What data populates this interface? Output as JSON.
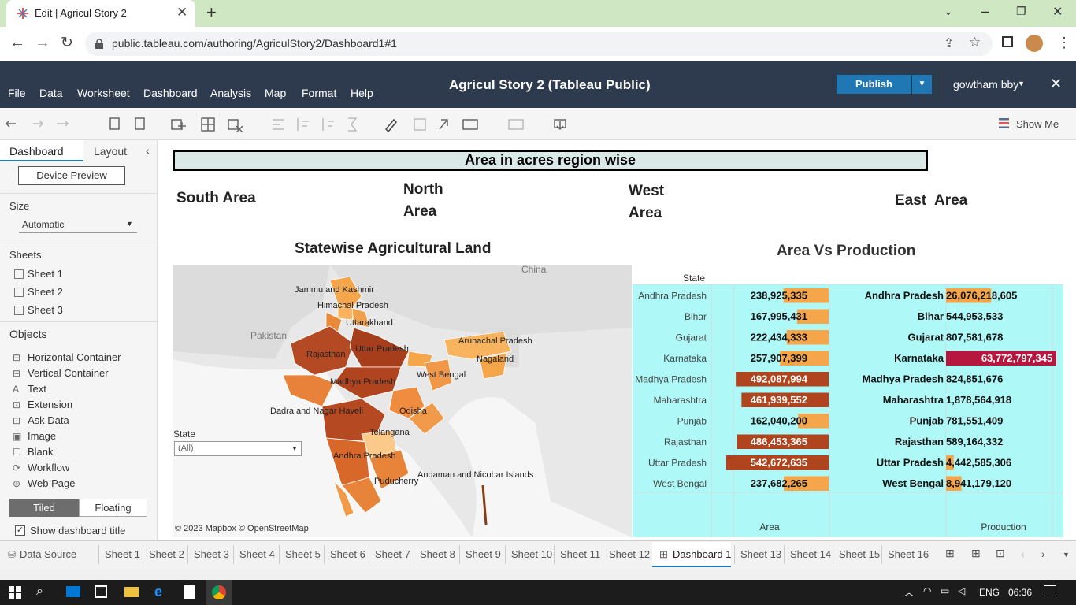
{
  "browser": {
    "tab_title": "Edit | Agricul Story 2",
    "new_tab": "+",
    "url": "public.tableau.com/authoring/AgriculStory2/Dashboard1#1"
  },
  "tableau": {
    "menu": [
      "File",
      "Data",
      "Worksheet",
      "Dashboard",
      "Analysis",
      "Map",
      "Format",
      "Help"
    ],
    "title": "Agricul Story 2 (Tableau Public)",
    "publish_label": "Publish",
    "user": "gowtham bby",
    "show_me": "Show Me"
  },
  "sidebar": {
    "tab_dashboard": "Dashboard",
    "tab_layout": "Layout",
    "device_preview": "Device Preview",
    "size_heading": "Size",
    "size_value": "Automatic",
    "sheets_heading": "Sheets",
    "sheets": [
      "Sheet 1",
      "Sheet 2",
      "Sheet 3"
    ],
    "objects_heading": "Objects",
    "objects": [
      {
        "label": "Horizontal Container",
        "icon": "horizontal-container-icon"
      },
      {
        "label": "Vertical Container",
        "icon": "vertical-container-icon"
      },
      {
        "label": "Text",
        "icon": "text-icon"
      },
      {
        "label": "Extension",
        "icon": "extension-icon"
      },
      {
        "label": "Ask Data",
        "icon": "ask-data-icon"
      },
      {
        "label": "Image",
        "icon": "image-icon"
      },
      {
        "label": "Blank",
        "icon": "blank-icon"
      },
      {
        "label": "Workflow",
        "icon": "workflow-icon"
      },
      {
        "label": "Web Page",
        "icon": "web-page-icon"
      }
    ],
    "tiled": "Tiled",
    "floating": "Floating",
    "show_title": "Show dashboard title"
  },
  "dashboard": {
    "header": "Area in acres region wise",
    "regions": {
      "south": "South Area",
      "north": "North Area",
      "west": "West Area",
      "east": "East  Area"
    },
    "map_title": "Statewise Agricultural Land",
    "map_labels": [
      "Jammu and Kashmir",
      "Himachal Pradesh",
      "Uttarakhand",
      "Pakistan",
      "Rajasthan",
      "Uttar Pradesh",
      "Arunachal Pradesh",
      "Nagaland",
      "China",
      "Madhya Pradesh",
      "West Bengal",
      "Dadra and Nagar Haveli",
      "Odisha",
      "Telangana",
      "Andhra Pradesh",
      "Puducherry",
      "Andaman and Nicobar Islands"
    ],
    "state_filter_label": "State",
    "state_filter_value": "(All)",
    "map_credit": "© 2023 Mapbox  © OpenStreetMap",
    "chart_title": "Area Vs Production"
  },
  "chart_data": {
    "type": "table",
    "title": "Area Vs Production",
    "row_header": "State",
    "columns": [
      "Area",
      "Production"
    ],
    "rows": [
      {
        "state": "Andhra Pradesh",
        "area": 238925335,
        "area_label": "238,925,335",
        "production": 26076218605,
        "production_label": "26,076,218,605"
      },
      {
        "state": "Bihar",
        "area": 167995431,
        "area_label": "167,995,431",
        "production": 544953533,
        "production_label": "544,953,533"
      },
      {
        "state": "Gujarat",
        "area": 222434333,
        "area_label": "222,434,333",
        "production": 807581678,
        "production_label": "807,581,678"
      },
      {
        "state": "Karnataka",
        "area": 257907399,
        "area_label": "257,907,399",
        "production": 63772797345,
        "production_label": "63,772,797,345"
      },
      {
        "state": "Madhya Pradesh",
        "area": 492087994,
        "area_label": "492,087,994",
        "production": 824851676,
        "production_label": "824,851,676"
      },
      {
        "state": "Maharashtra",
        "area": 461939552,
        "area_label": "461,939,552",
        "production": 1878564918,
        "production_label": "1,878,564,918"
      },
      {
        "state": "Punjab",
        "area": 162040200,
        "area_label": "162,040,200",
        "production": 781551409,
        "production_label": "781,551,409"
      },
      {
        "state": "Rajasthan",
        "area": 486453365,
        "area_label": "486,453,365",
        "production": 589164332,
        "production_label": "589,164,332"
      },
      {
        "state": "Uttar Pradesh",
        "area": 542672635,
        "area_label": "542,672,635",
        "production": 4442585306,
        "production_label": "4,442,585,306"
      },
      {
        "state": "West Bengal",
        "area": 237682265,
        "area_label": "237,682,265",
        "production": 8941179120,
        "production_label": "8,941,179,120"
      }
    ],
    "colors": {
      "area_low": "#f5a54a",
      "area_high": "#b0441e",
      "production_high": "#b5173f",
      "production_low": "#fde0b8"
    }
  },
  "sheet_tabs": {
    "data_source": "Data Source",
    "tabs": [
      "Sheet 1",
      "Sheet 2",
      "Sheet 3",
      "Sheet 4",
      "Sheet 5",
      "Sheet 6",
      "Sheet 7",
      "Sheet 8",
      "Sheet 9",
      "Sheet 10",
      "Sheet 11",
      "Sheet 12",
      "Dashboard 1",
      "Sheet 13",
      "Sheet 14",
      "Sheet 15",
      "Sheet 16"
    ],
    "active": "Dashboard 1"
  },
  "taskbar": {
    "lang": "ENG",
    "time": "06:36"
  }
}
